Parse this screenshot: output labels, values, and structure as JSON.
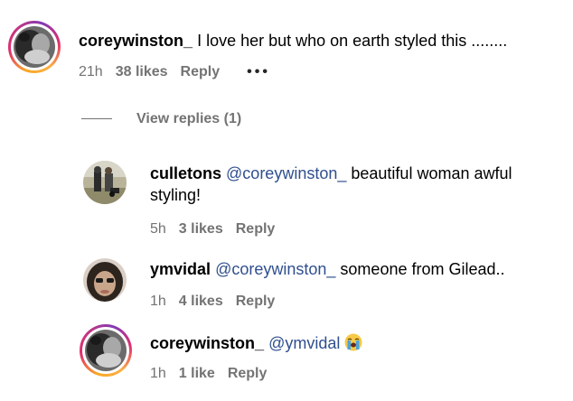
{
  "comments": [
    {
      "username": "coreywinston_",
      "mention": "",
      "text": "I love her but who on earth styled this ........",
      "time": "21h",
      "likes": "38 likes",
      "reply": "Reply",
      "more": "•••"
    },
    {
      "username": "culletons",
      "mention": "@coreywinston_",
      "text_line1": "beautiful woman awful",
      "text_line2": "styling!",
      "time": "5h",
      "likes": "3 likes",
      "reply": "Reply"
    },
    {
      "username": "ymvidal",
      "mention": "@coreywinston_",
      "text": "someone from Gilead..",
      "time": "1h",
      "likes": "4 likes",
      "reply": "Reply"
    },
    {
      "username": "coreywinston_",
      "mention": "@ymvidal",
      "emoji": "loudly-crying-face",
      "time": "1h",
      "likes": "1 like",
      "reply": "Reply"
    }
  ],
  "view_replies": "View replies (1)",
  "colors": {
    "mention": "#2f4f8f",
    "meta": "#737373",
    "story_ring": "#e1306c"
  }
}
